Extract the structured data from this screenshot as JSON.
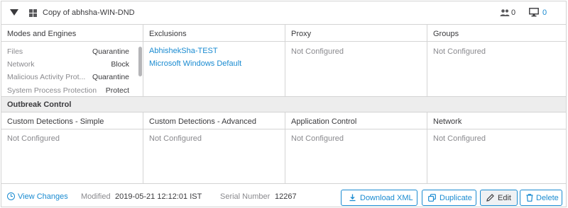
{
  "header": {
    "title": "Copy of abhsha-WIN-DND",
    "users_count": "0",
    "computers_count": "0"
  },
  "columns": {
    "modes": {
      "title": "Modes and Engines",
      "rows": [
        {
          "label": "Files",
          "value": "Quarantine"
        },
        {
          "label": "Network",
          "value": "Block"
        },
        {
          "label": "Malicious Activity Prot...",
          "value": "Quarantine"
        },
        {
          "label": "System Process Protection",
          "value": "Protect"
        }
      ]
    },
    "exclusions": {
      "title": "Exclusions",
      "items": [
        "AbhishekSha-TEST",
        "Microsoft Windows Default"
      ]
    },
    "proxy": {
      "title": "Proxy",
      "value": "Not Configured"
    },
    "groups": {
      "title": "Groups",
      "value": "Not Configured"
    }
  },
  "outbreak": {
    "title": "Outbreak Control",
    "columns": [
      {
        "title": "Custom Detections - Simple",
        "value": "Not Configured"
      },
      {
        "title": "Custom Detections - Advanced",
        "value": "Not Configured"
      },
      {
        "title": "Application Control",
        "value": "Not Configured"
      },
      {
        "title": "Network",
        "value": "Not Configured"
      }
    ]
  },
  "footer": {
    "view_changes": "View Changes",
    "modified_label": "Modified",
    "modified_value": "2019-05-21 12:12:01 IST",
    "serial_label": "Serial Number",
    "serial_value": "12267",
    "buttons": {
      "download": "Download XML",
      "duplicate": "Duplicate",
      "edit": "Edit",
      "delete": "Delete"
    }
  },
  "colors": {
    "accent": "#1a8bd1",
    "border": "#d4d4d4",
    "section_bg": "#ededed"
  },
  "icons": [
    "caret-down-icon",
    "windows-icon",
    "users-icon",
    "monitor-icon",
    "clock-icon",
    "download-icon",
    "duplicate-icon",
    "pencil-icon",
    "trash-icon"
  ]
}
